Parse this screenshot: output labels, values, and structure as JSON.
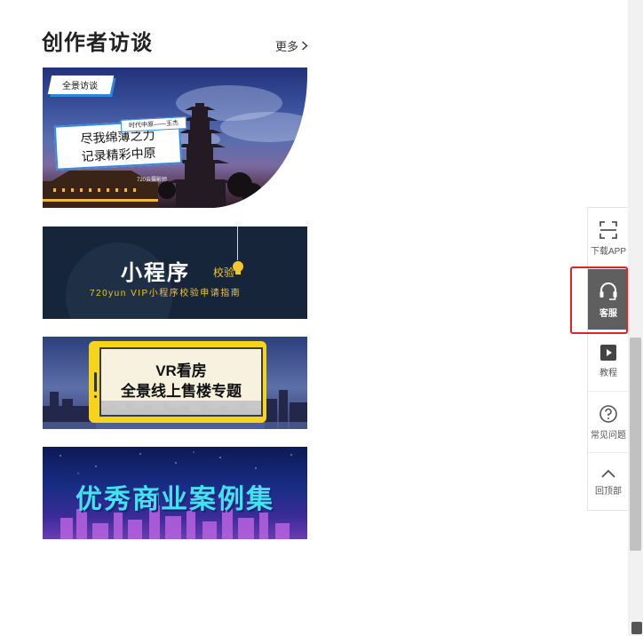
{
  "section": {
    "title": "创作者访谈",
    "more_label": "更多"
  },
  "banners": {
    "b1": {
      "tag": "全景访谈",
      "small_label": "时代中原——王杰",
      "headline_1": "尽我绵薄之力",
      "headline_2": "记录精彩中原",
      "credit": "720云摄影师"
    },
    "b2": {
      "title": "小程序",
      "subtitle": "校验",
      "line": "720yun VIP小程序校验申请指南"
    },
    "b3": {
      "line1": "VR看房",
      "line2": "全景线上售楼专题"
    },
    "b4": {
      "title": "优秀商业案例集"
    }
  },
  "toolbar": {
    "items": [
      {
        "label": "下载APP",
        "icon": "scan-icon"
      },
      {
        "label": "客服",
        "icon": "headset-icon",
        "active": true
      },
      {
        "label": "教程",
        "icon": "play-icon"
      },
      {
        "label": "常见问题",
        "icon": "question-icon"
      },
      {
        "label": "回顶部",
        "icon": "chevron-up-icon"
      }
    ]
  },
  "colors": {
    "highlight_border": "#e62121",
    "active_tool_bg": "#5f5f5f",
    "accent_yellow": "#f2c531",
    "accent_cyan": "#42e3ee"
  }
}
